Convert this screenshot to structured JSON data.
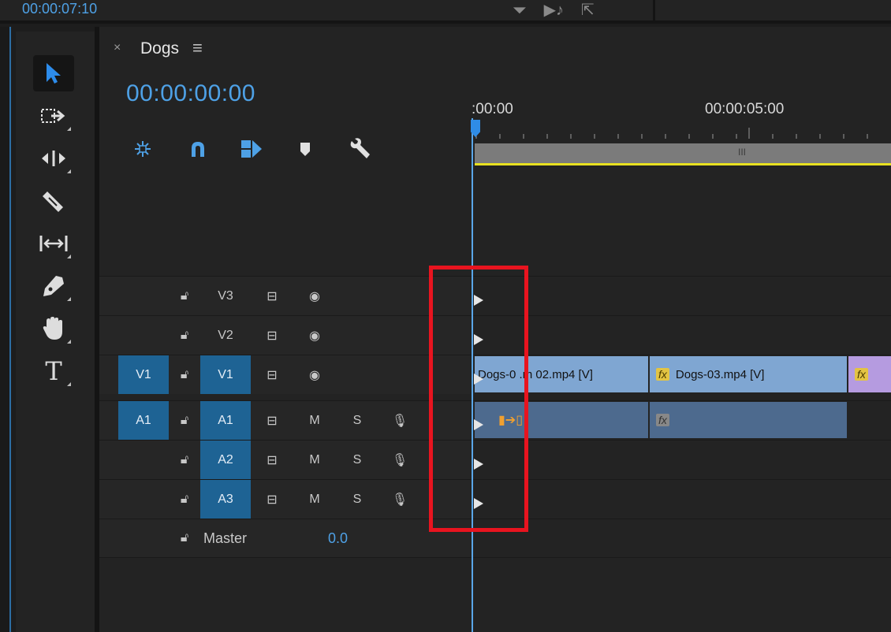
{
  "top": {
    "timecode": "00:00:07:10"
  },
  "sequence": {
    "tab_close": "×",
    "name": "Dogs",
    "menu_glyph": "≡",
    "timecode": "00:00:00:00"
  },
  "ruler": {
    "start_label": ":00:00",
    "mid_label": "00:00:05:00",
    "work_area_grip": "III"
  },
  "tracks": {
    "video": [
      {
        "source": "",
        "target": "V3",
        "target_active": false
      },
      {
        "source": "",
        "target": "V2",
        "target_active": false
      },
      {
        "source": "V1",
        "target": "V1",
        "target_active": true
      }
    ],
    "audio": [
      {
        "source": "A1",
        "target": "A1",
        "mute": "M",
        "solo": "S"
      },
      {
        "source": "",
        "target": "A2",
        "mute": "M",
        "solo": "S"
      },
      {
        "source": "",
        "target": "A3",
        "mute": "M",
        "solo": "S"
      }
    ],
    "master": {
      "label": "Master",
      "value": "0.0"
    }
  },
  "clips": {
    "video": [
      {
        "label": "Dogs-0 .m 02.mp4 [V]"
      },
      {
        "label": "Dogs-03.mp4 [V]",
        "fx": "fx"
      },
      {
        "label": "",
        "fx": "fx"
      }
    ],
    "audio": [
      {
        "label": ""
      },
      {
        "label": "",
        "fx": "fx"
      }
    ]
  },
  "icons": {
    "tools": [
      "selection-tool-icon",
      "track-select-forward-icon",
      "ripple-edit-icon",
      "razor-icon",
      "slip-icon",
      "pen-icon",
      "hand-icon",
      "type-icon"
    ],
    "controls": [
      "insert-overwrite-sequences-icon",
      "snap-icon",
      "linked-selection-icon",
      "add-marker-icon",
      "timeline-settings-icon"
    ]
  },
  "colors": {
    "accent": "#4ea1e6",
    "target_track": "#1e6394",
    "video_clip": "#7fa6d2",
    "audio_clip": "#4d6a8e",
    "adjustment_clip": "#b59be0",
    "work_area": "#e8e021",
    "highlight_box": "#e8141f"
  }
}
